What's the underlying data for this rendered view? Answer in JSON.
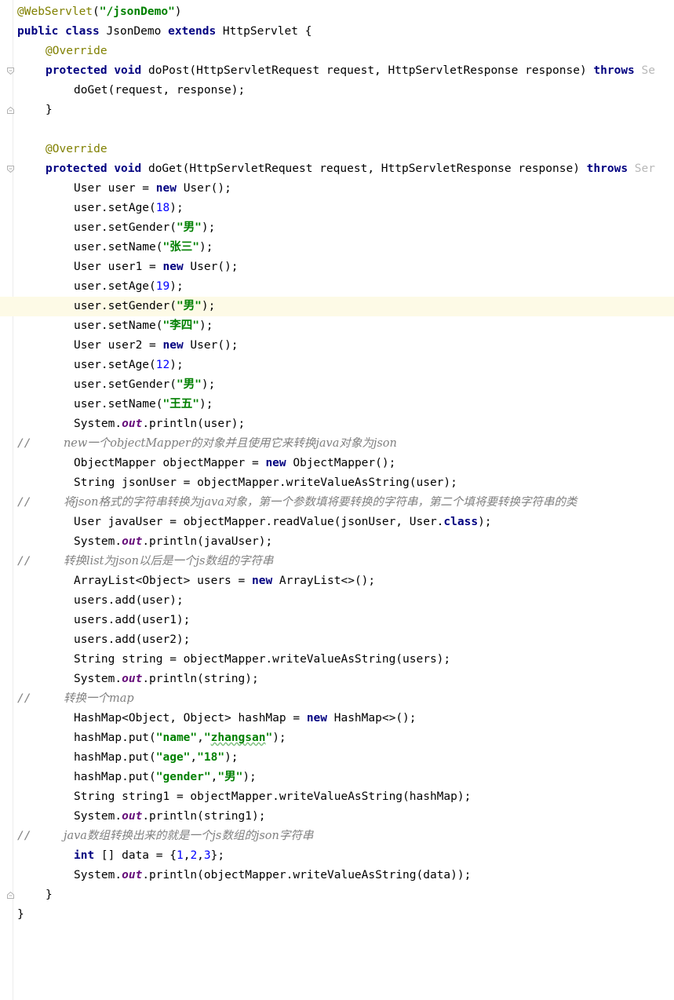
{
  "editor": {
    "lines": [
      "@WebServlet(\"/jsonDemo\")",
      "public class JsonDemo extends HttpServlet {",
      "@Override",
      "protected void doPost(HttpServletRequest request, HttpServletResponse response) throws Se",
      "doGet(request, response);",
      "}",
      "",
      "@Override",
      "protected void doGet(HttpServletRequest request, HttpServletResponse response) throws Ser",
      "User user = new User();",
      "user.setAge(18);",
      "user.setGender(\"男\");",
      "user.setName(\"张三\");",
      "User user1 = new User();",
      "user.setAge(19);",
      "user.setGender(\"男\");",
      "user.setName(\"李四\");",
      "User user2 = new User();",
      "user.setAge(12);",
      "user.setGender(\"男\");",
      "user.setName(\"王五\");",
      "System.out.println(user);",
      "//         new一个objectMapper的对象并且使用它来转换java对象为json",
      "ObjectMapper objectMapper = new ObjectMapper();",
      "String jsonUser = objectMapper.writeValueAsString(user);",
      "//         将json格式的字符串转换为java对象，第一个参数填将要转换的字符串，第二个填将要转换字符串的类",
      "User javaUser = objectMapper.readValue(jsonUser, User.class);",
      "System.out.println(javaUser);",
      "//         转换list为json以后是一个js数组的字符串",
      "ArrayList<Object> users = new ArrayList<>();",
      "users.add(user);",
      "users.add(user1);",
      "users.add(user2);",
      "String string = objectMapper.writeValueAsString(users);",
      "System.out.println(string);",
      "//         转换一个map",
      "HashMap<Object, Object> hashMap = new HashMap<>();",
      "hashMap.put(\"name\",\"zhangsan\");",
      "hashMap.put(\"age\",\"18\");",
      "hashMap.put(\"gender\",\"男\");",
      "String string1 = objectMapper.writeValueAsString(hashMap);",
      "System.out.println(string1);",
      "//         java数组转换出来的就是一个js数组的json字符串",
      "int [] data = {1,2,3};",
      "System.out.println(objectMapper.writeValueAsString(data));",
      "}",
      "}"
    ],
    "current_line_index": 15,
    "colors": {
      "keyword": "#000080",
      "annotation": "#808000",
      "string": "#008000",
      "number": "#0000ff",
      "static_field": "#660e7a",
      "comment": "#808080",
      "current_line_bg": "#fdfae6"
    }
  }
}
